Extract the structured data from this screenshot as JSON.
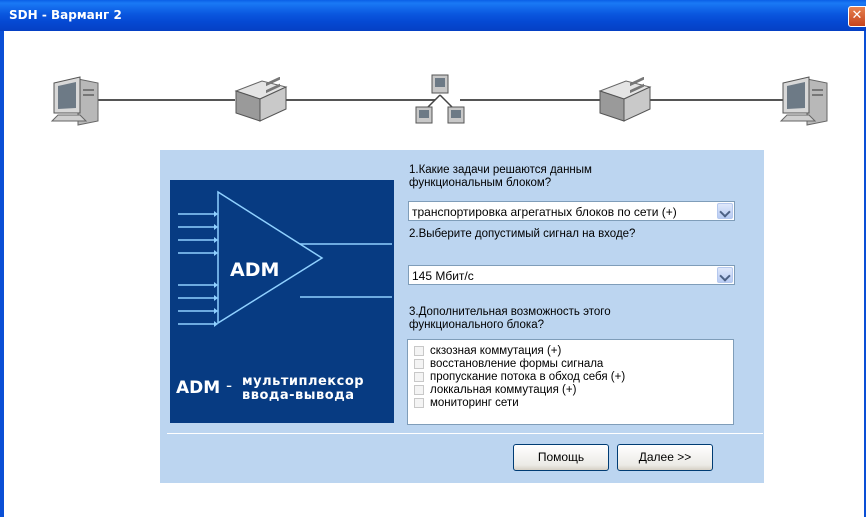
{
  "window": {
    "title": "SDH - Варманг 2",
    "close_glyph": "✕"
  },
  "network": {
    "devices": [
      {
        "name": "computer-icon-left"
      },
      {
        "name": "multiplexer-icon-left"
      },
      {
        "name": "network-hub-icon"
      },
      {
        "name": "multiplexer-icon-right"
      },
      {
        "name": "computer-icon-right"
      }
    ]
  },
  "image": {
    "label": "ADM",
    "caption_abbr": "ADM",
    "caption_dash": "-",
    "caption_line1": "мультиплексор",
    "caption_line2": "ввода-вывода",
    "background_color": "#073b82"
  },
  "question1": {
    "text": "1.Какие задачи решаются данным функциональным блоком?",
    "selected": "транспортировка агрегатных блоков по сети (+)"
  },
  "question2": {
    "text": "2.Выберите допустимый сигнал на входе?",
    "selected": "145 Мбит/с"
  },
  "question3": {
    "text": "3.Дополнительная возможность этого функционального блока?",
    "options": [
      {
        "label": "скзозная коммутация (+)",
        "checked": false
      },
      {
        "label": "восстановление формы сигнала",
        "checked": false
      },
      {
        "label": "пропускание потока в обход себя (+)",
        "checked": false
      },
      {
        "label": "локкальная коммутация (+)",
        "checked": false
      },
      {
        "label": "мониторинг сети",
        "checked": false
      }
    ]
  },
  "buttons": {
    "help": "Помощь",
    "next": "Далее >>"
  },
  "colors": {
    "panel": "#bcd5f0",
    "titlebar": "#0a57df"
  }
}
